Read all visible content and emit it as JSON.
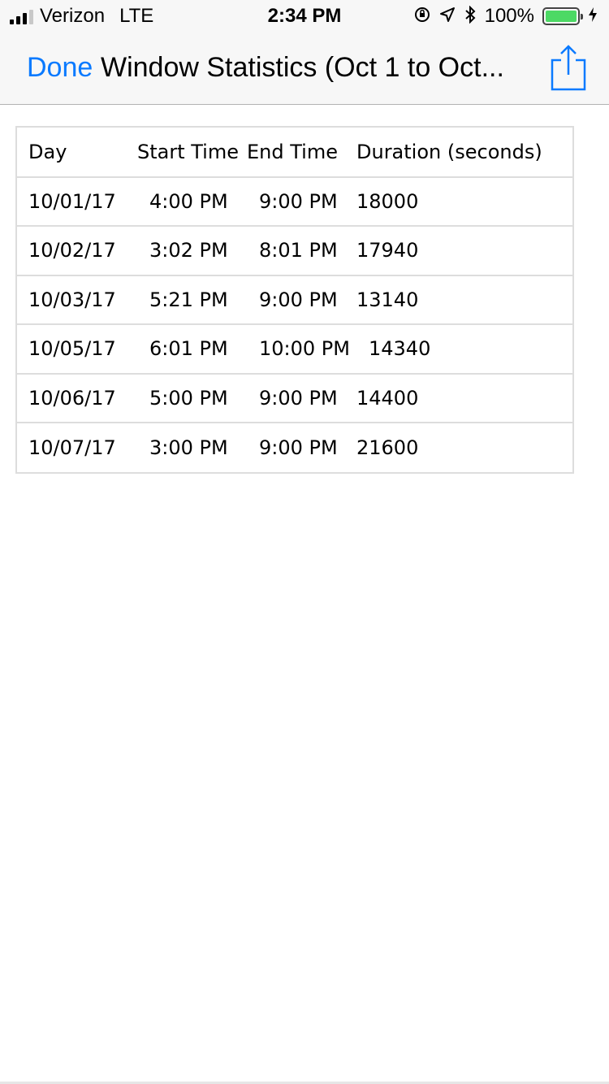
{
  "status_bar": {
    "carrier": "Verizon",
    "network": "LTE",
    "time": "2:34 PM",
    "battery_percent": "100%",
    "icons": [
      "signal-icon",
      "orientation-lock-icon",
      "location-icon",
      "bluetooth-icon",
      "battery-icon",
      "charging-icon"
    ],
    "battery_color": "#4cd964"
  },
  "nav": {
    "done_label": "Done",
    "title": "Window Statistics (Oct 1 to Oct...",
    "share_icon": "share-icon",
    "accent_color": "#0a7aff"
  },
  "table": {
    "headers": [
      "Day",
      "Start Time",
      "End Time",
      "Duration (seconds)"
    ],
    "rows": [
      [
        "10/01/17",
        "4:00 PM",
        "9:00 PM",
        "18000"
      ],
      [
        "10/02/17",
        "3:02 PM",
        "8:01 PM",
        "17940"
      ],
      [
        "10/03/17",
        "5:21 PM",
        "9:00 PM",
        "13140"
      ],
      [
        "10/05/17",
        "6:01 PM",
        "10:00 PM",
        "14340"
      ],
      [
        "10/06/17",
        "5:00 PM",
        "9:00 PM",
        "14400"
      ],
      [
        "10/07/17",
        "3:00 PM",
        "9:00 PM",
        "21600"
      ]
    ]
  }
}
